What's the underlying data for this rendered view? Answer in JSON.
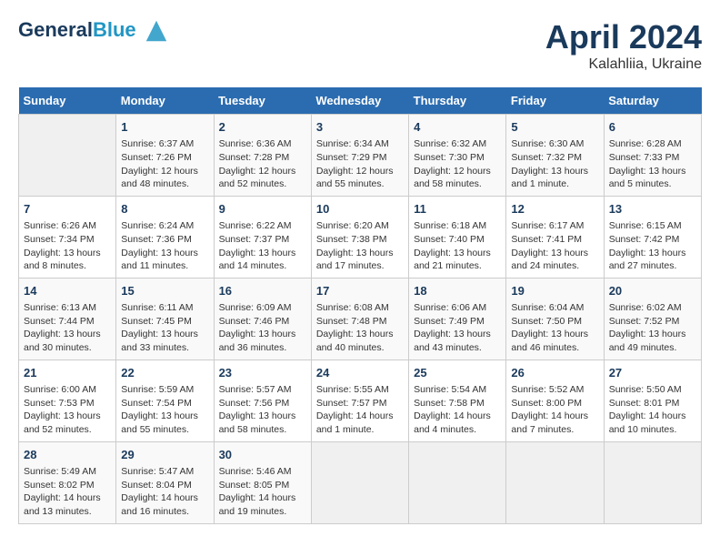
{
  "header": {
    "logo_line1": "General",
    "logo_line2": "Blue",
    "title": "April 2024",
    "subtitle": "Kalahliia, Ukraine"
  },
  "weekdays": [
    "Sunday",
    "Monday",
    "Tuesday",
    "Wednesday",
    "Thursday",
    "Friday",
    "Saturday"
  ],
  "weeks": [
    [
      {
        "day": "",
        "sunrise": "",
        "sunset": "",
        "daylight": ""
      },
      {
        "day": "1",
        "sunrise": "Sunrise: 6:37 AM",
        "sunset": "Sunset: 7:26 PM",
        "daylight": "Daylight: 12 hours and 48 minutes."
      },
      {
        "day": "2",
        "sunrise": "Sunrise: 6:36 AM",
        "sunset": "Sunset: 7:28 PM",
        "daylight": "Daylight: 12 hours and 52 minutes."
      },
      {
        "day": "3",
        "sunrise": "Sunrise: 6:34 AM",
        "sunset": "Sunset: 7:29 PM",
        "daylight": "Daylight: 12 hours and 55 minutes."
      },
      {
        "day": "4",
        "sunrise": "Sunrise: 6:32 AM",
        "sunset": "Sunset: 7:30 PM",
        "daylight": "Daylight: 12 hours and 58 minutes."
      },
      {
        "day": "5",
        "sunrise": "Sunrise: 6:30 AM",
        "sunset": "Sunset: 7:32 PM",
        "daylight": "Daylight: 13 hours and 1 minute."
      },
      {
        "day": "6",
        "sunrise": "Sunrise: 6:28 AM",
        "sunset": "Sunset: 7:33 PM",
        "daylight": "Daylight: 13 hours and 5 minutes."
      }
    ],
    [
      {
        "day": "7",
        "sunrise": "Sunrise: 6:26 AM",
        "sunset": "Sunset: 7:34 PM",
        "daylight": "Daylight: 13 hours and 8 minutes."
      },
      {
        "day": "8",
        "sunrise": "Sunrise: 6:24 AM",
        "sunset": "Sunset: 7:36 PM",
        "daylight": "Daylight: 13 hours and 11 minutes."
      },
      {
        "day": "9",
        "sunrise": "Sunrise: 6:22 AM",
        "sunset": "Sunset: 7:37 PM",
        "daylight": "Daylight: 13 hours and 14 minutes."
      },
      {
        "day": "10",
        "sunrise": "Sunrise: 6:20 AM",
        "sunset": "Sunset: 7:38 PM",
        "daylight": "Daylight: 13 hours and 17 minutes."
      },
      {
        "day": "11",
        "sunrise": "Sunrise: 6:18 AM",
        "sunset": "Sunset: 7:40 PM",
        "daylight": "Daylight: 13 hours and 21 minutes."
      },
      {
        "day": "12",
        "sunrise": "Sunrise: 6:17 AM",
        "sunset": "Sunset: 7:41 PM",
        "daylight": "Daylight: 13 hours and 24 minutes."
      },
      {
        "day": "13",
        "sunrise": "Sunrise: 6:15 AM",
        "sunset": "Sunset: 7:42 PM",
        "daylight": "Daylight: 13 hours and 27 minutes."
      }
    ],
    [
      {
        "day": "14",
        "sunrise": "Sunrise: 6:13 AM",
        "sunset": "Sunset: 7:44 PM",
        "daylight": "Daylight: 13 hours and 30 minutes."
      },
      {
        "day": "15",
        "sunrise": "Sunrise: 6:11 AM",
        "sunset": "Sunset: 7:45 PM",
        "daylight": "Daylight: 13 hours and 33 minutes."
      },
      {
        "day": "16",
        "sunrise": "Sunrise: 6:09 AM",
        "sunset": "Sunset: 7:46 PM",
        "daylight": "Daylight: 13 hours and 36 minutes."
      },
      {
        "day": "17",
        "sunrise": "Sunrise: 6:08 AM",
        "sunset": "Sunset: 7:48 PM",
        "daylight": "Daylight: 13 hours and 40 minutes."
      },
      {
        "day": "18",
        "sunrise": "Sunrise: 6:06 AM",
        "sunset": "Sunset: 7:49 PM",
        "daylight": "Daylight: 13 hours and 43 minutes."
      },
      {
        "day": "19",
        "sunrise": "Sunrise: 6:04 AM",
        "sunset": "Sunset: 7:50 PM",
        "daylight": "Daylight: 13 hours and 46 minutes."
      },
      {
        "day": "20",
        "sunrise": "Sunrise: 6:02 AM",
        "sunset": "Sunset: 7:52 PM",
        "daylight": "Daylight: 13 hours and 49 minutes."
      }
    ],
    [
      {
        "day": "21",
        "sunrise": "Sunrise: 6:00 AM",
        "sunset": "Sunset: 7:53 PM",
        "daylight": "Daylight: 13 hours and 52 minutes."
      },
      {
        "day": "22",
        "sunrise": "Sunrise: 5:59 AM",
        "sunset": "Sunset: 7:54 PM",
        "daylight": "Daylight: 13 hours and 55 minutes."
      },
      {
        "day": "23",
        "sunrise": "Sunrise: 5:57 AM",
        "sunset": "Sunset: 7:56 PM",
        "daylight": "Daylight: 13 hours and 58 minutes."
      },
      {
        "day": "24",
        "sunrise": "Sunrise: 5:55 AM",
        "sunset": "Sunset: 7:57 PM",
        "daylight": "Daylight: 14 hours and 1 minute."
      },
      {
        "day": "25",
        "sunrise": "Sunrise: 5:54 AM",
        "sunset": "Sunset: 7:58 PM",
        "daylight": "Daylight: 14 hours and 4 minutes."
      },
      {
        "day": "26",
        "sunrise": "Sunrise: 5:52 AM",
        "sunset": "Sunset: 8:00 PM",
        "daylight": "Daylight: 14 hours and 7 minutes."
      },
      {
        "day": "27",
        "sunrise": "Sunrise: 5:50 AM",
        "sunset": "Sunset: 8:01 PM",
        "daylight": "Daylight: 14 hours and 10 minutes."
      }
    ],
    [
      {
        "day": "28",
        "sunrise": "Sunrise: 5:49 AM",
        "sunset": "Sunset: 8:02 PM",
        "daylight": "Daylight: 14 hours and 13 minutes."
      },
      {
        "day": "29",
        "sunrise": "Sunrise: 5:47 AM",
        "sunset": "Sunset: 8:04 PM",
        "daylight": "Daylight: 14 hours and 16 minutes."
      },
      {
        "day": "30",
        "sunrise": "Sunrise: 5:46 AM",
        "sunset": "Sunset: 8:05 PM",
        "daylight": "Daylight: 14 hours and 19 minutes."
      },
      {
        "day": "",
        "sunrise": "",
        "sunset": "",
        "daylight": ""
      },
      {
        "day": "",
        "sunrise": "",
        "sunset": "",
        "daylight": ""
      },
      {
        "day": "",
        "sunrise": "",
        "sunset": "",
        "daylight": ""
      },
      {
        "day": "",
        "sunrise": "",
        "sunset": "",
        "daylight": ""
      }
    ]
  ]
}
